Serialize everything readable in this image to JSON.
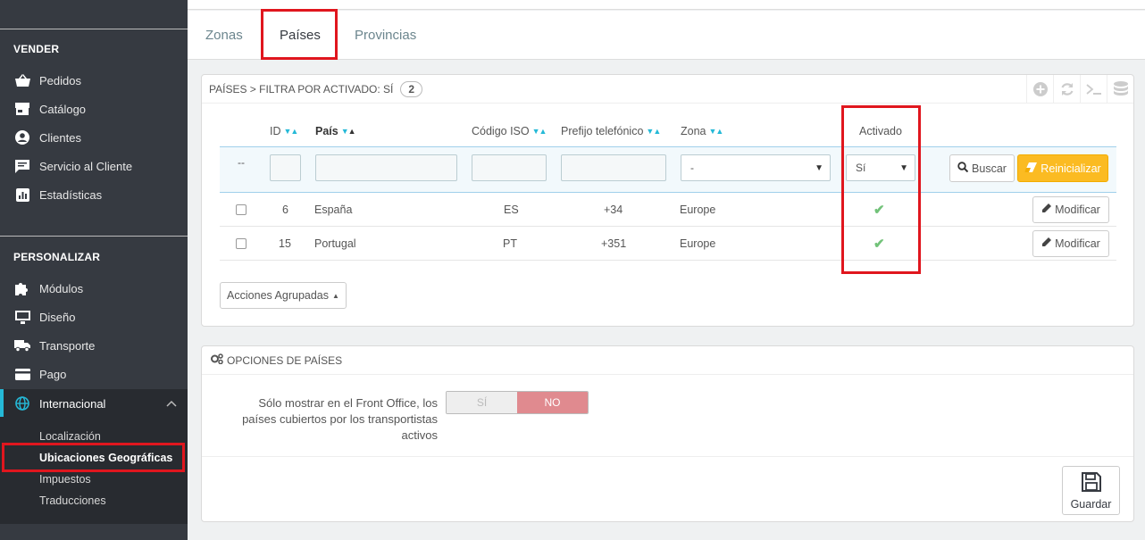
{
  "sidebar": {
    "sections": [
      {
        "title": "VENDER",
        "items": [
          {
            "label": "Pedidos",
            "icon": "basket-icon"
          },
          {
            "label": "Catálogo",
            "icon": "store-icon"
          },
          {
            "label": "Clientes",
            "icon": "user-circle-icon"
          },
          {
            "label": "Servicio al Cliente",
            "icon": "chat-icon"
          },
          {
            "label": "Estadísticas",
            "icon": "bar-chart-icon"
          }
        ]
      },
      {
        "title": "PERSONALIZAR",
        "items": [
          {
            "label": "Módulos",
            "icon": "puzzle-icon"
          },
          {
            "label": "Diseño",
            "icon": "monitor-icon"
          },
          {
            "label": "Transporte",
            "icon": "truck-icon"
          },
          {
            "label": "Pago",
            "icon": "credit-card-icon"
          },
          {
            "label": "Internacional",
            "icon": "globe-icon"
          }
        ]
      }
    ],
    "submenu": [
      "Localización",
      "Ubicaciones Geográficas",
      "Impuestos",
      "Traducciones"
    ]
  },
  "tabs": [
    "Zonas",
    "Países",
    "Provincias"
  ],
  "list": {
    "heading": "PAÍSES > FILTRA POR ACTIVADO: SÍ",
    "count": "2",
    "columns": {
      "id": "ID",
      "country": "País",
      "iso": "Código ISO",
      "prefix": "Prefijo telefónico",
      "zone": "Zona",
      "active": "Activado"
    },
    "filters": {
      "bulk": "--",
      "zone_value": "-",
      "active_value": "Sí"
    },
    "search_label": "Buscar",
    "reset_label": "Reinicializar",
    "rows": [
      {
        "id": "6",
        "country": "España",
        "iso": "ES",
        "prefix": "+34",
        "zone": "Europe",
        "edit": "Modificar"
      },
      {
        "id": "15",
        "country": "Portugal",
        "iso": "PT",
        "prefix": "+351",
        "zone": "Europe",
        "edit": "Modificar"
      }
    ],
    "bulk_label": "Acciones Agrupadas"
  },
  "options": {
    "heading": "OPCIONES DE PAÍSES",
    "label_line1": "Sólo mostrar en el Front Office, los",
    "label_line2": "países cubiertos por los transportistas",
    "label_line3": "activos",
    "yes": "SÍ",
    "no": "NO",
    "save_label": "Guardar"
  },
  "colors": {
    "accent": "#25b9d7",
    "warning": "#fbbb22",
    "highlight": "#e0161e",
    "no_active": "#e08a8f",
    "check": "#72c279"
  }
}
